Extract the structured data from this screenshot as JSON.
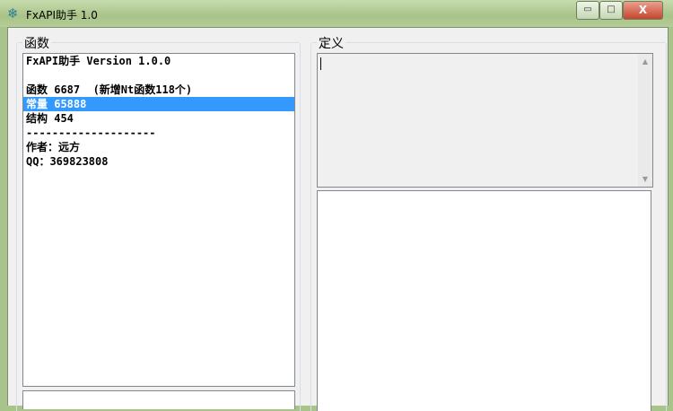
{
  "window": {
    "title": "FxAPI助手 1.0",
    "controls": {
      "minimize": "▭",
      "maximize": "□",
      "close": "X"
    }
  },
  "groups": {
    "functions_label": "函数",
    "definition_label": "定义"
  },
  "list": {
    "items": [
      "FxAPI助手 Version 1.0.0",
      "",
      "函数 6687  (新增Nt函数118个)",
      "常量 65888",
      "结构 454",
      "--------------------",
      "作者：远方",
      "QQ：369823808"
    ],
    "selected_index": 3
  },
  "scroll": {
    "up": "▲",
    "down": "▼"
  }
}
